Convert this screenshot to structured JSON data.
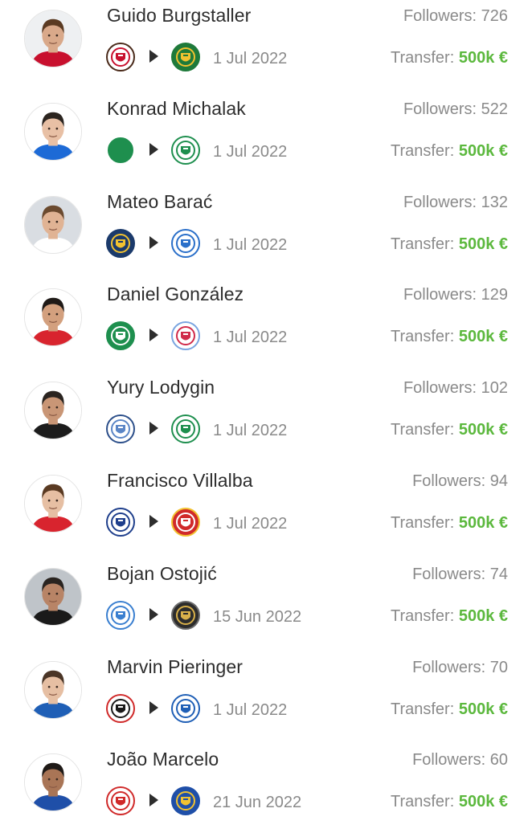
{
  "transfer_label": "Transfer:",
  "colors": {
    "fee": "#5bb83d",
    "name": "#2d2d2d",
    "muted": "#8a8a8a",
    "avatar_bg": "#dde3ea"
  },
  "players": [
    {
      "name": "Guido Burgstaller",
      "followers": "Followers: 726",
      "date": "1 Jul 2022",
      "fee": "500k €",
      "from_icon": "st-pauli-crest-icon",
      "to_icon": "rapid-wien-crest-icon",
      "from_colors": [
        "#ffffff",
        "#c8102e",
        "#4a2a1a"
      ],
      "to_colors": [
        "#1f7a3a",
        "#f2c230",
        "#1f7a3a"
      ],
      "kit": "#c8102e",
      "skin": "#d9a98a",
      "hair": "#5a3a22",
      "bg": "#eef0f2"
    },
    {
      "name": "Konrad Michalak",
      "followers": "Followers: 522",
      "date": "1 Jul 2022",
      "fee": "500k €",
      "from_icon": "akhmat-crest-icon",
      "to_icon": "konyaspor-crest-icon",
      "from_colors": [
        "#1e8f4e",
        "#1e8f4e",
        "#ffffff"
      ],
      "to_colors": [
        "#ffffff",
        "#1e8f4e",
        "#1e8f4e"
      ],
      "kit": "#1d6ad6",
      "skin": "#e8c0a5",
      "hair": "#2c2520",
      "bg": "#ffffff"
    },
    {
      "name": "Mateo Barać",
      "followers": "Followers: 132",
      "date": "1 Jul 2022",
      "fee": "500k €",
      "from_icon": "rostov-crest-icon",
      "to_icon": "krylia-sovetov-crest-icon",
      "from_colors": [
        "#1b3a6b",
        "#f2c230",
        "#1b3a6b"
      ],
      "to_colors": [
        "#ffffff",
        "#2a6fc9",
        "#2a6fc9"
      ],
      "kit": "#ffffff",
      "skin": "#e0b394",
      "hair": "#6b4a2f",
      "bg": "#d9dde2"
    },
    {
      "name": "Daniel González",
      "followers": "Followers: 129",
      "date": "1 Jul 2022",
      "fee": "500k €",
      "from_icon": "santiago-wanderers-crest-icon",
      "to_icon": "rayo-crest-icon",
      "from_colors": [
        "#1e8f4e",
        "#ffffff",
        "#1e8f4e"
      ],
      "to_colors": [
        "#ffffff",
        "#d02a4a",
        "#7aa5e0"
      ],
      "kit": "#d8242e",
      "skin": "#d3a07e",
      "hair": "#1f1a17",
      "bg": "#ffffff"
    },
    {
      "name": "Yury Lodygin",
      "followers": "Followers: 102",
      "date": "1 Jul 2022",
      "fee": "500k €",
      "from_icon": "pas-giannina-crest-icon",
      "to_icon": "panathinaikos-crest-icon",
      "from_colors": [
        "#ffffff",
        "#5b86c6",
        "#2c4f8a"
      ],
      "to_colors": [
        "#ffffff",
        "#1e8f4e",
        "#1e8f4e"
      ],
      "kit": "#1c1c1c",
      "skin": "#c99676",
      "hair": "#2a2420",
      "bg": "#ffffff"
    },
    {
      "name": "Francisco Villalba",
      "followers": "Followers: 94",
      "date": "1 Jul 2022",
      "fee": "500k €",
      "from_icon": "birmingham-crest-icon",
      "to_icon": "sporting-gijon-crest-icon",
      "from_colors": [
        "#ffffff",
        "#1f3f8c",
        "#1f3f8c"
      ],
      "to_colors": [
        "#d02a2a",
        "#ffffff",
        "#f2c230"
      ],
      "kit": "#d8242e",
      "skin": "#e6bfa3",
      "hair": "#5a3a22",
      "bg": "#ffffff"
    },
    {
      "name": "Bojan Ostojić",
      "followers": "Followers: 74",
      "date": "15 Jun 2022",
      "fee": "500k €",
      "from_icon": "buriram-crest-icon",
      "to_icon": "kawasaki-frontale-crest-icon",
      "from_colors": [
        "#ffffff",
        "#3a7fd0",
        "#3a7fd0"
      ],
      "to_colors": [
        "#2c2c2c",
        "#d8b04a",
        "#6b6b6b"
      ],
      "kit": "#1a1a1a",
      "skin": "#b88466",
      "hair": "#2a2420",
      "bg": "#bfc4c9"
    },
    {
      "name": "Marvin Pieringer",
      "followers": "Followers: 70",
      "date": "1 Jul 2022",
      "fee": "500k €",
      "from_icon": "freiburg-crest-icon",
      "to_icon": "schalke-crest-icon",
      "from_colors": [
        "#ffffff",
        "#1a1a1a",
        "#d02a2a"
      ],
      "to_colors": [
        "#ffffff",
        "#1f5fb6",
        "#1f5fb6"
      ],
      "kit": "#1f5fb6",
      "skin": "#e6bfa3",
      "hair": "#4a3526",
      "bg": "#ffffff"
    },
    {
      "name": "João Marcelo",
      "followers": "Followers: 60",
      "date": "21 Jun 2022",
      "fee": "500k €",
      "from_icon": "ferroviario-crest-icon",
      "to_icon": "porto-crest-icon",
      "from_colors": [
        "#ffffff",
        "#d02a2a",
        "#d02a2a"
      ],
      "to_colors": [
        "#1f4fa8",
        "#f2c230",
        "#1f4fa8"
      ],
      "kit": "#1f4fa8",
      "skin": "#a97556",
      "hair": "#1f1a17",
      "bg": "#ffffff"
    }
  ]
}
